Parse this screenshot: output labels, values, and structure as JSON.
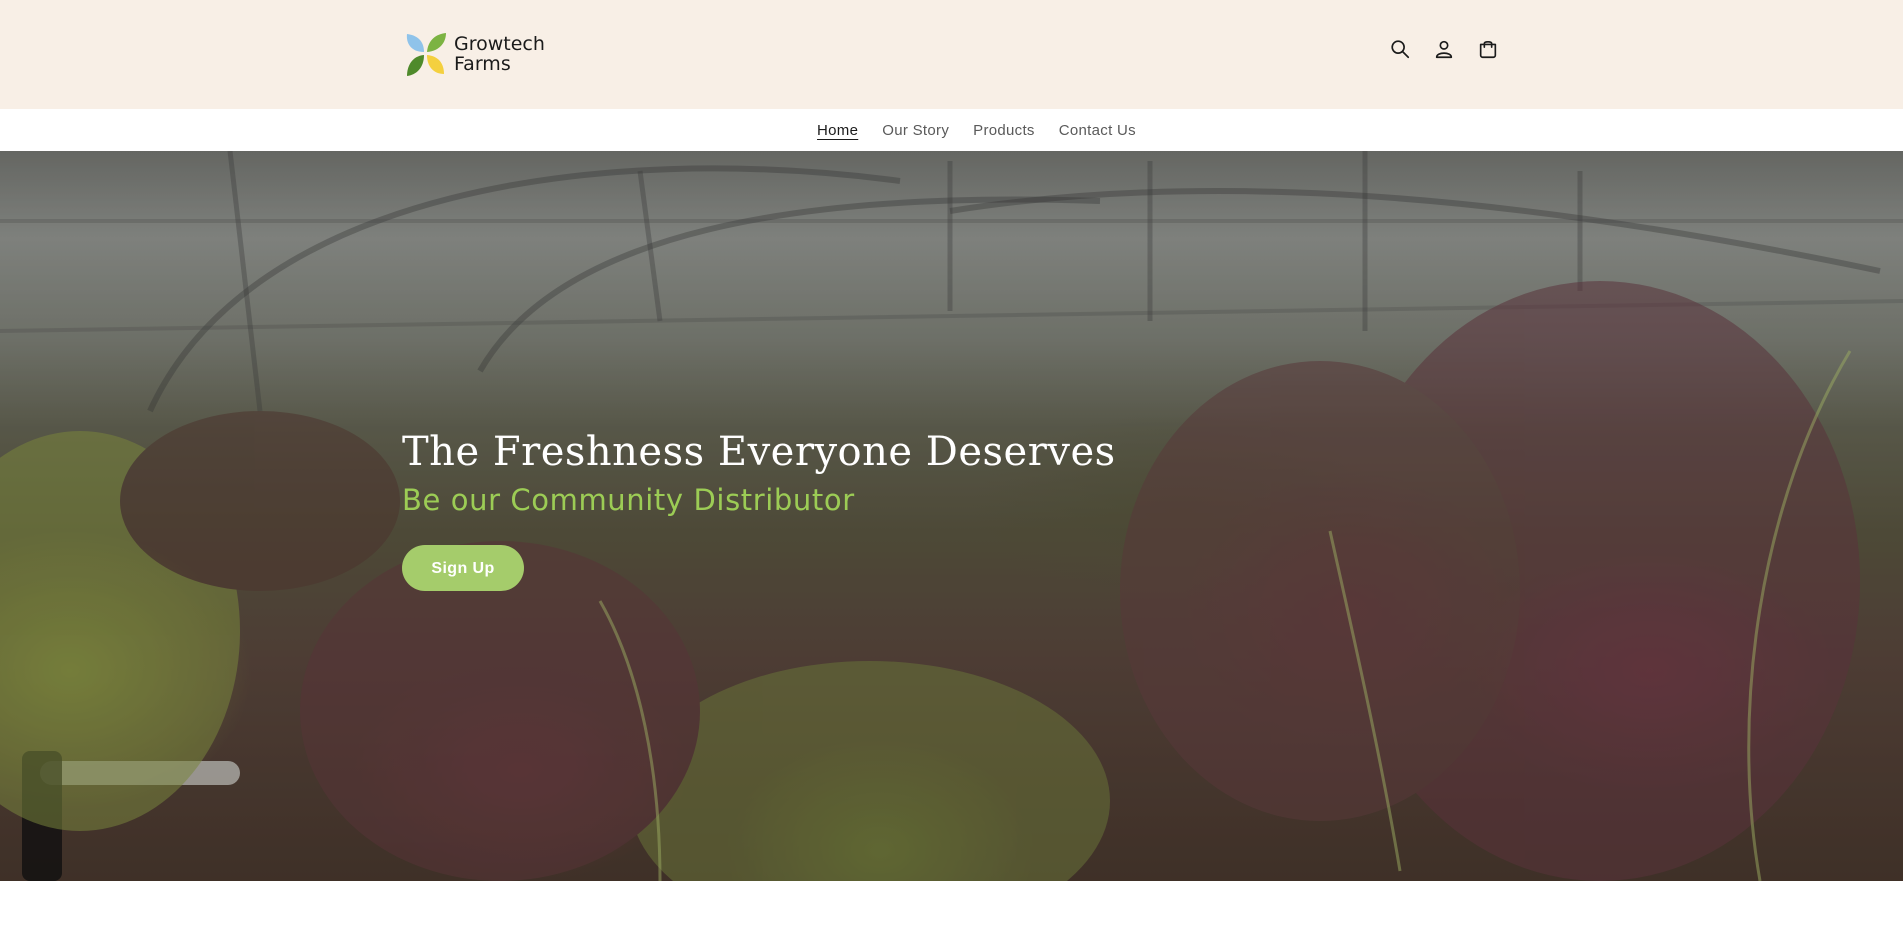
{
  "brand": {
    "name_line1": "Growtech",
    "name_line2": "Farms",
    "logo_colors": [
      "#8fc3ea",
      "#7cb342",
      "#f4d03f",
      "#4f8a2b"
    ]
  },
  "header": {
    "icons": [
      "search-icon",
      "account-icon",
      "cart-icon"
    ]
  },
  "nav": {
    "items": [
      {
        "label": "Home",
        "active": true
      },
      {
        "label": "Our Story",
        "active": false
      },
      {
        "label": "Products",
        "active": false
      },
      {
        "label": "Contact Us",
        "active": false
      }
    ]
  },
  "hero": {
    "title": "The Freshness Everyone Deserves",
    "subtitle": "Be our Community Distributor",
    "cta_label": "Sign Up",
    "accent_color": "#9ccc55",
    "button_color": "#a5cc6b"
  },
  "colors": {
    "header_bg": "#f8efe6",
    "nav_bg": "#ffffff"
  }
}
